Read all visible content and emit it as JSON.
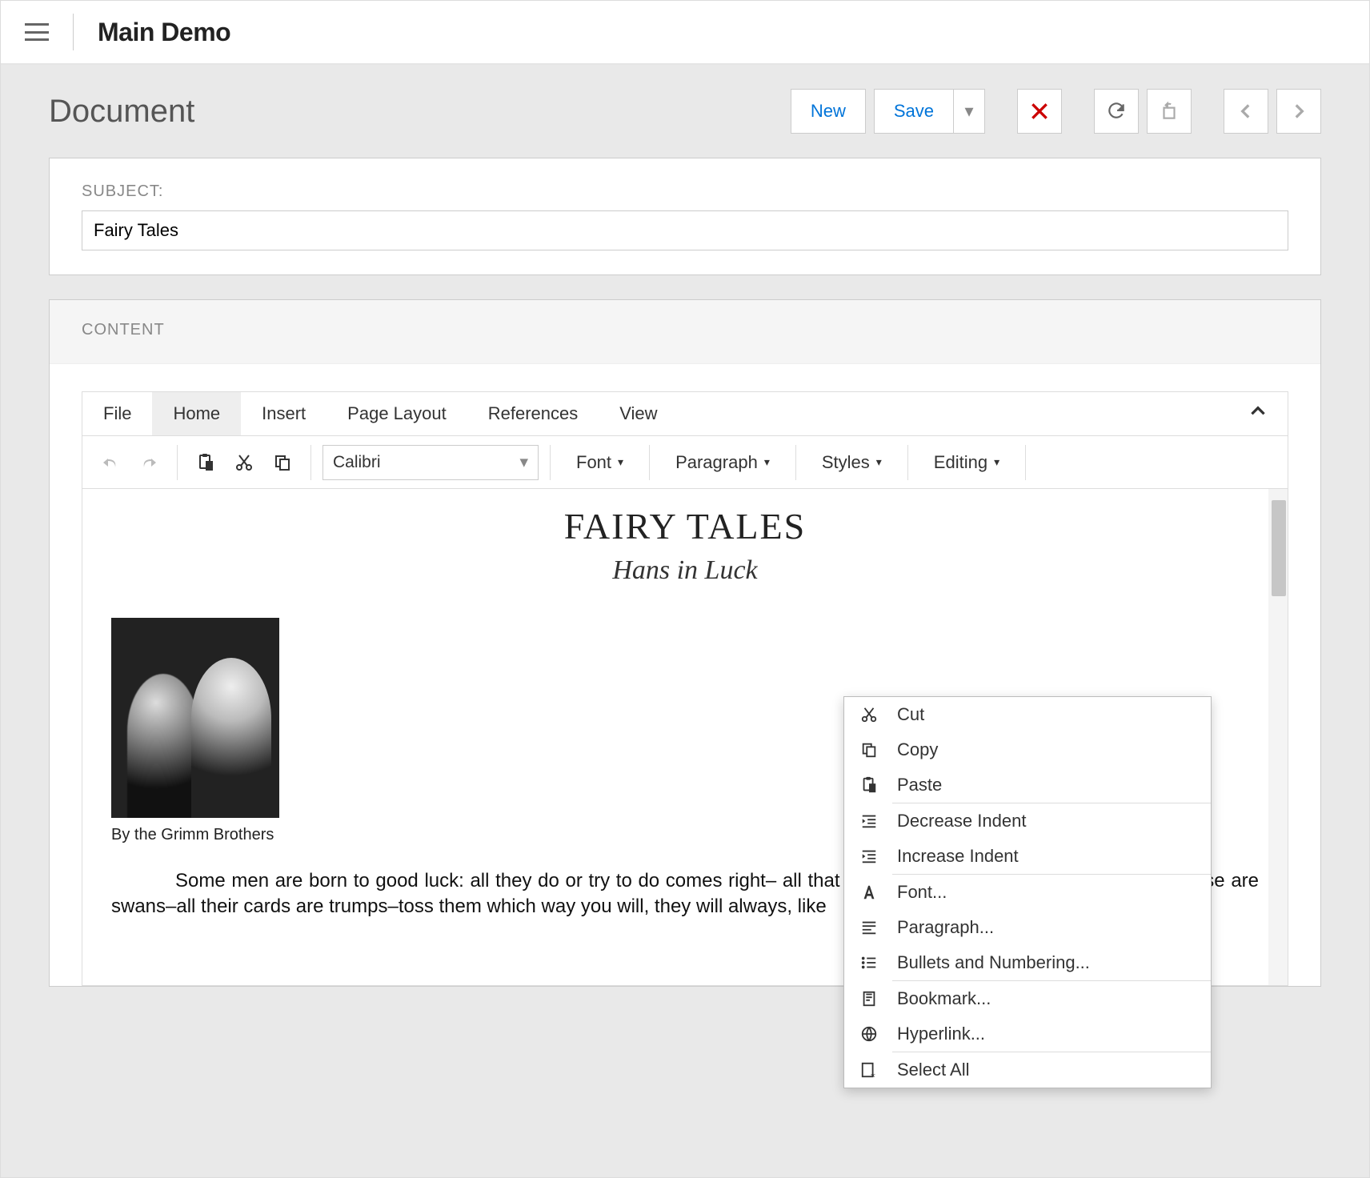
{
  "app_title": "Main Demo",
  "page_title": "Document",
  "toolbar": {
    "new_label": "New",
    "save_label": "Save"
  },
  "form": {
    "subject_label": "SUBJECT:",
    "subject_value": "Fairy Tales",
    "content_label": "CONTENT"
  },
  "ribbon": {
    "tabs": [
      "File",
      "Home",
      "Insert",
      "Page Layout",
      "References",
      "View"
    ],
    "active_tab": "Home",
    "font_value": "Calibri",
    "groups": [
      "Font",
      "Paragraph",
      "Styles",
      "Editing"
    ]
  },
  "document": {
    "title": "FAIRY TALES",
    "subtitle": "Hans in Luck",
    "caption": "By the Grimm Brothers",
    "body": "Some men are born to good luck: all they do or try to do comes right– all that falls to them is so much gain–all their geese are swans–all their cards are trumps–toss them which way you will, they will always, like"
  },
  "context_menu": {
    "items": [
      {
        "icon": "cut",
        "label": "Cut"
      },
      {
        "icon": "copy",
        "label": "Copy"
      },
      {
        "icon": "paste",
        "label": "Paste"
      },
      {
        "sep": true
      },
      {
        "icon": "dec-indent",
        "label": "Decrease Indent"
      },
      {
        "icon": "inc-indent",
        "label": "Increase Indent"
      },
      {
        "sep": true
      },
      {
        "icon": "font",
        "label": "Font..."
      },
      {
        "icon": "paragraph",
        "label": "Paragraph..."
      },
      {
        "icon": "bullets",
        "label": "Bullets and Numbering..."
      },
      {
        "sep": true
      },
      {
        "icon": "bookmark",
        "label": "Bookmark..."
      },
      {
        "icon": "hyperlink",
        "label": "Hyperlink..."
      },
      {
        "sep": true
      },
      {
        "icon": "select-all",
        "label": "Select All"
      }
    ]
  }
}
